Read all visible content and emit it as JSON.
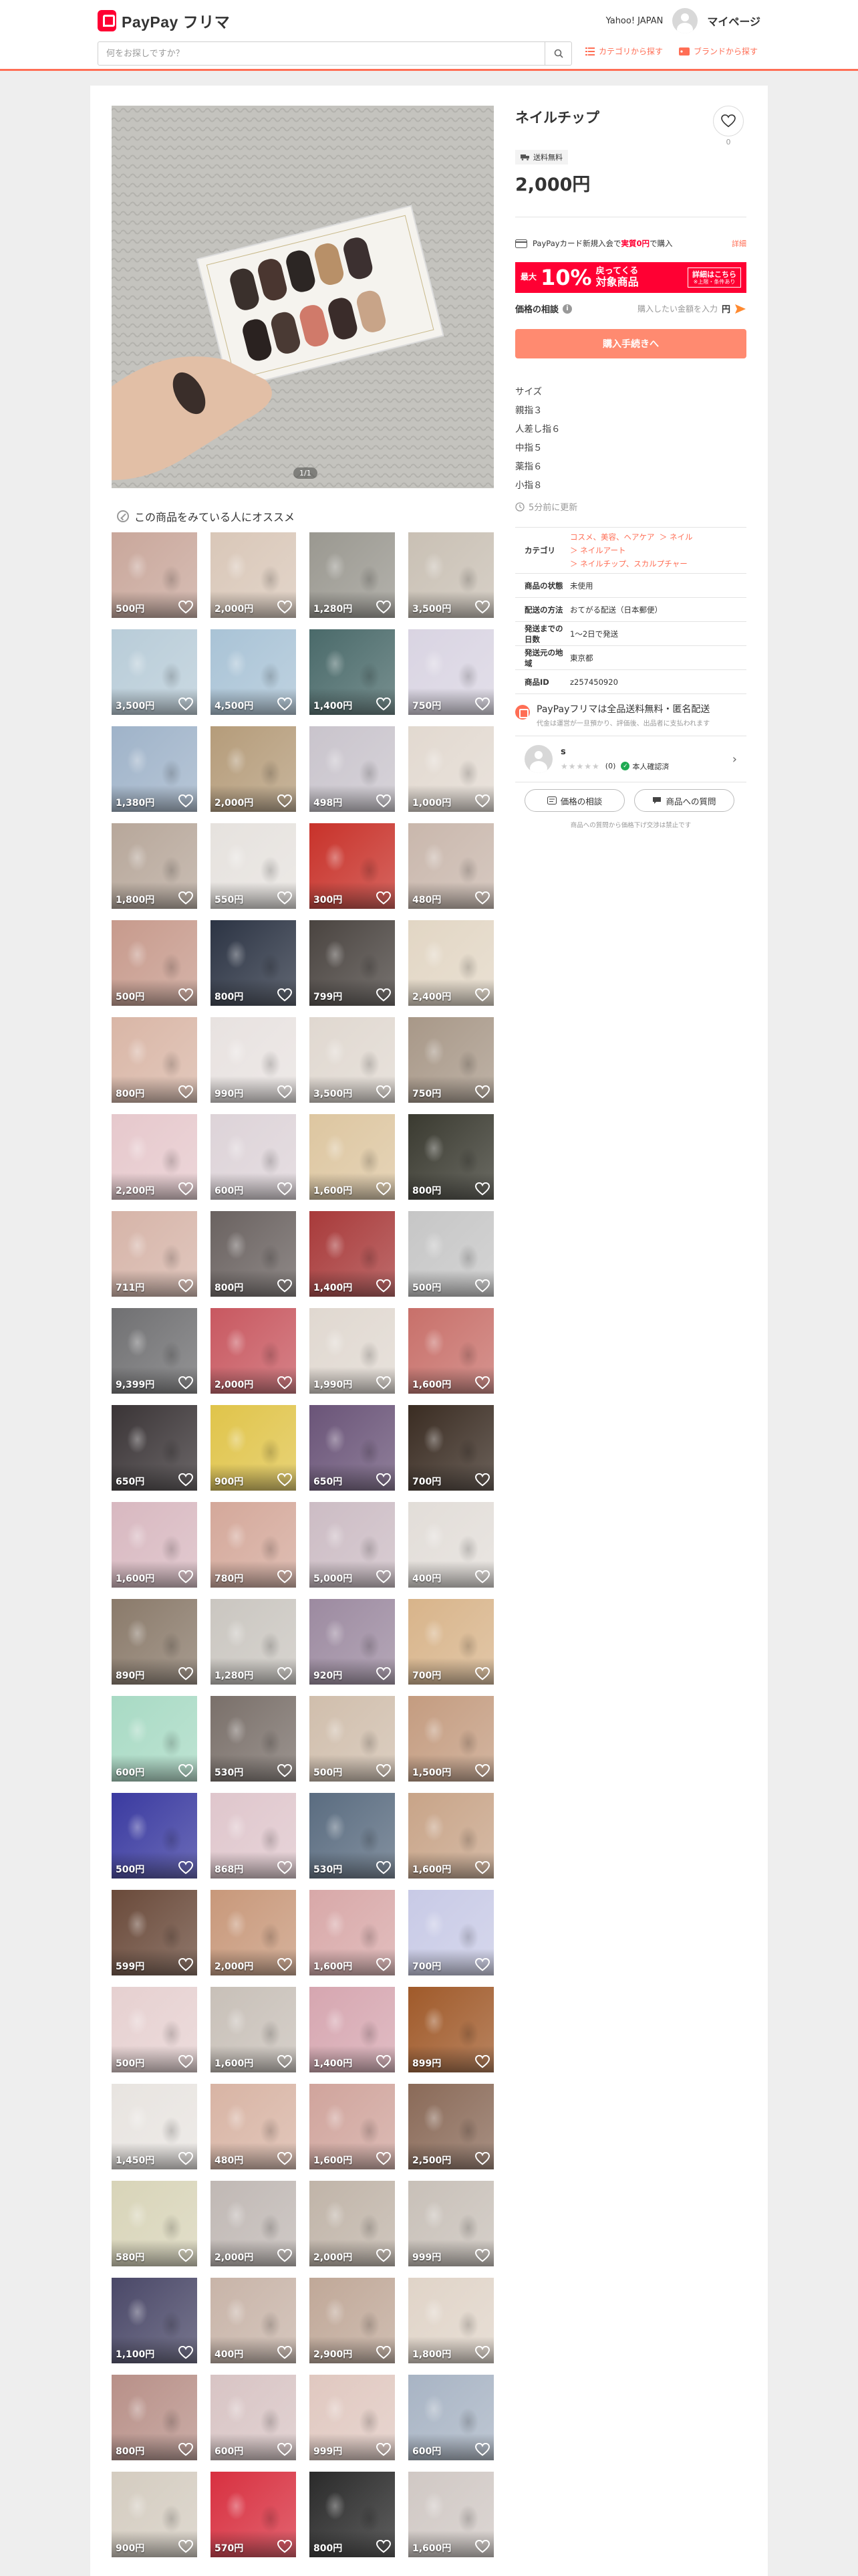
{
  "header": {
    "logo_text": "PayPay フリマ",
    "yahoo_label": "Yahoo! JAPAN",
    "mypage_label": "マイページ",
    "search_placeholder": "何をお探しですか？",
    "category_link": "カテゴリから探す",
    "brand_link": "ブランドから探す"
  },
  "product": {
    "image_counter": "1/1",
    "title": "ネイルチップ",
    "like_count": "0",
    "shipping_badge": "送料無料",
    "price": "2,000円",
    "card_line_prefix": "PayPayカード新規入会で",
    "card_line_emphasis": "実質0円",
    "card_line_suffix": "で購入",
    "card_detail": "詳細",
    "banner": {
      "left": "最大",
      "big": "10%",
      "mid_top": "戻ってくる",
      "mid_bottom": "対象商品",
      "box_top": "詳細はこちら",
      "box_bottom": "※上限・条件あり"
    },
    "negotiation_label": "価格の相談",
    "negotiation_placeholder": "購入したい金額を入力",
    "negotiation_unit": "円",
    "buy_button": "購入手続きへ",
    "description": "サイズ\n親指３\n人差し指６\n中指５\n薬指６\n小指８",
    "updated": "5分前に更新",
    "specs": {
      "category_key": "カテゴリ",
      "category_values": [
        "コスメ、美容、ヘアケア",
        "ネイル",
        "ネイルアート",
        "ネイルチップ、スカルプチャー"
      ],
      "condition_key": "商品の状態",
      "condition_val": "未使用",
      "shipping_method_key": "配送の方法",
      "shipping_method_val": "おてがる配送（日本郵便）",
      "days_key": "発送までの日数",
      "days_val": "1〜2日で発送",
      "region_key": "発送元の地域",
      "region_val": "東京都",
      "id_key": "商品ID",
      "id_val": "z257450920"
    },
    "promo_title": "PayPayフリマは全品送料無料・匿名配送",
    "promo_sub": "代金は運営が一旦預かり、評価後、出品者に支払われます",
    "seller_name": "s",
    "seller_rating_count": "(0)",
    "seller_verified": "本人確認済",
    "negotiate_button": "価格の相談",
    "question_button": "商品への質問",
    "note": "商品への質問から価格下げ交渉は禁止です"
  },
  "recommend": {
    "title": "この商品をみている人にオススメ",
    "prices": [
      "500円",
      "2,000円",
      "1,280円",
      "3,500円",
      "3,500円",
      "4,500円",
      "1,400円",
      "750円",
      "1,380円",
      "2,000円",
      "498円",
      "1,000円",
      "1,800円",
      "550円",
      "300円",
      "480円",
      "500円",
      "800円",
      "799円",
      "2,400円",
      "800円",
      "990円",
      "3,500円",
      "750円",
      "2,200円",
      "600円",
      "1,600円",
      "800円",
      "711円",
      "800円",
      "1,400円",
      "500円",
      "9,399円",
      "2,000円",
      "1,990円",
      "1,600円",
      "650円",
      "900円",
      "650円",
      "700円",
      "1,600円",
      "780円",
      "5,000円",
      "400円",
      "890円",
      "1,280円",
      "920円",
      "700円",
      "600円",
      "530円",
      "500円",
      "1,500円",
      "500円",
      "868円",
      "530円",
      "1,600円",
      "599円",
      "2,000円",
      "1,600円",
      "700円",
      "500円",
      "1,600円",
      "1,400円",
      "899円",
      "1,450円",
      "480円",
      "1,600円",
      "2,500円",
      "580円",
      "2,000円",
      "2,000円",
      "999円",
      "1,100円",
      "400円",
      "2,900円",
      "1,800円",
      "800円",
      "600円",
      "999円",
      "600円",
      "900円",
      "570円",
      "800円",
      "1,600円"
    ],
    "colors": [
      "#c9a79b",
      "#d9c7b8",
      "#9a9890",
      "#c9c0b4",
      "#b8ccd8",
      "#a9c3d6",
      "#4a6a6a",
      "#d9d4e2",
      "#9fb3c9",
      "#b59c7a",
      "#c9c4cc",
      "#e2d9d0",
      "#b7a79a",
      "#e6e2de",
      "#c8322a",
      "#c9b7ac",
      "#c79a8c",
      "#2c3444",
      "#4a4440",
      "#e2d6c4",
      "#d9b6a6",
      "#e8e2e0",
      "#e0d8d0",
      "#a89888",
      "#e6c8cc",
      "#ddd3d8",
      "#ddc6a0",
      "#3a3a30",
      "#d6b4a8",
      "#6a6260",
      "#a83a3a",
      "#c6c6c6",
      "#707072",
      "#c85860",
      "#e0d8d0",
      "#c8706a",
      "#3a3436",
      "#e0c44a",
      "#6a5478",
      "#3a2c22",
      "#d8b8c0",
      "#d4a89a",
      "#ccbcc4",
      "#e2ddd8",
      "#8a7a6a",
      "#cac6c0",
      "#9c8aa0",
      "#d8b48a",
      "#a8dac4",
      "#7a706a",
      "#d0beac",
      "#c49c80",
      "#3a3aa0",
      "#dfc6cc",
      "#5a6c80",
      "#c8a488",
      "#6a4a3a",
      "#c8987a",
      "#d8a8a8",
      "#c8cae6",
      "#e6d0d0",
      "#c8c0b8",
      "#d6a6b0",
      "#a05a2a",
      "#e8e4e0",
      "#d8b4a4",
      "#d0a49c",
      "#8a6a58",
      "#d8d4b8",
      "#c0b8b4",
      "#c0b4a8",
      "#c8c0b8",
      "#4a4868",
      "#c8b4a8",
      "#c0a898",
      "#e0d4c8",
      "#b89088",
      "#d8c4c4",
      "#e0c8c0",
      "#a8b4c4",
      "#d4ccc0",
      "#d83040",
      "#2a2a2a",
      "#d0c8c4"
    ]
  }
}
